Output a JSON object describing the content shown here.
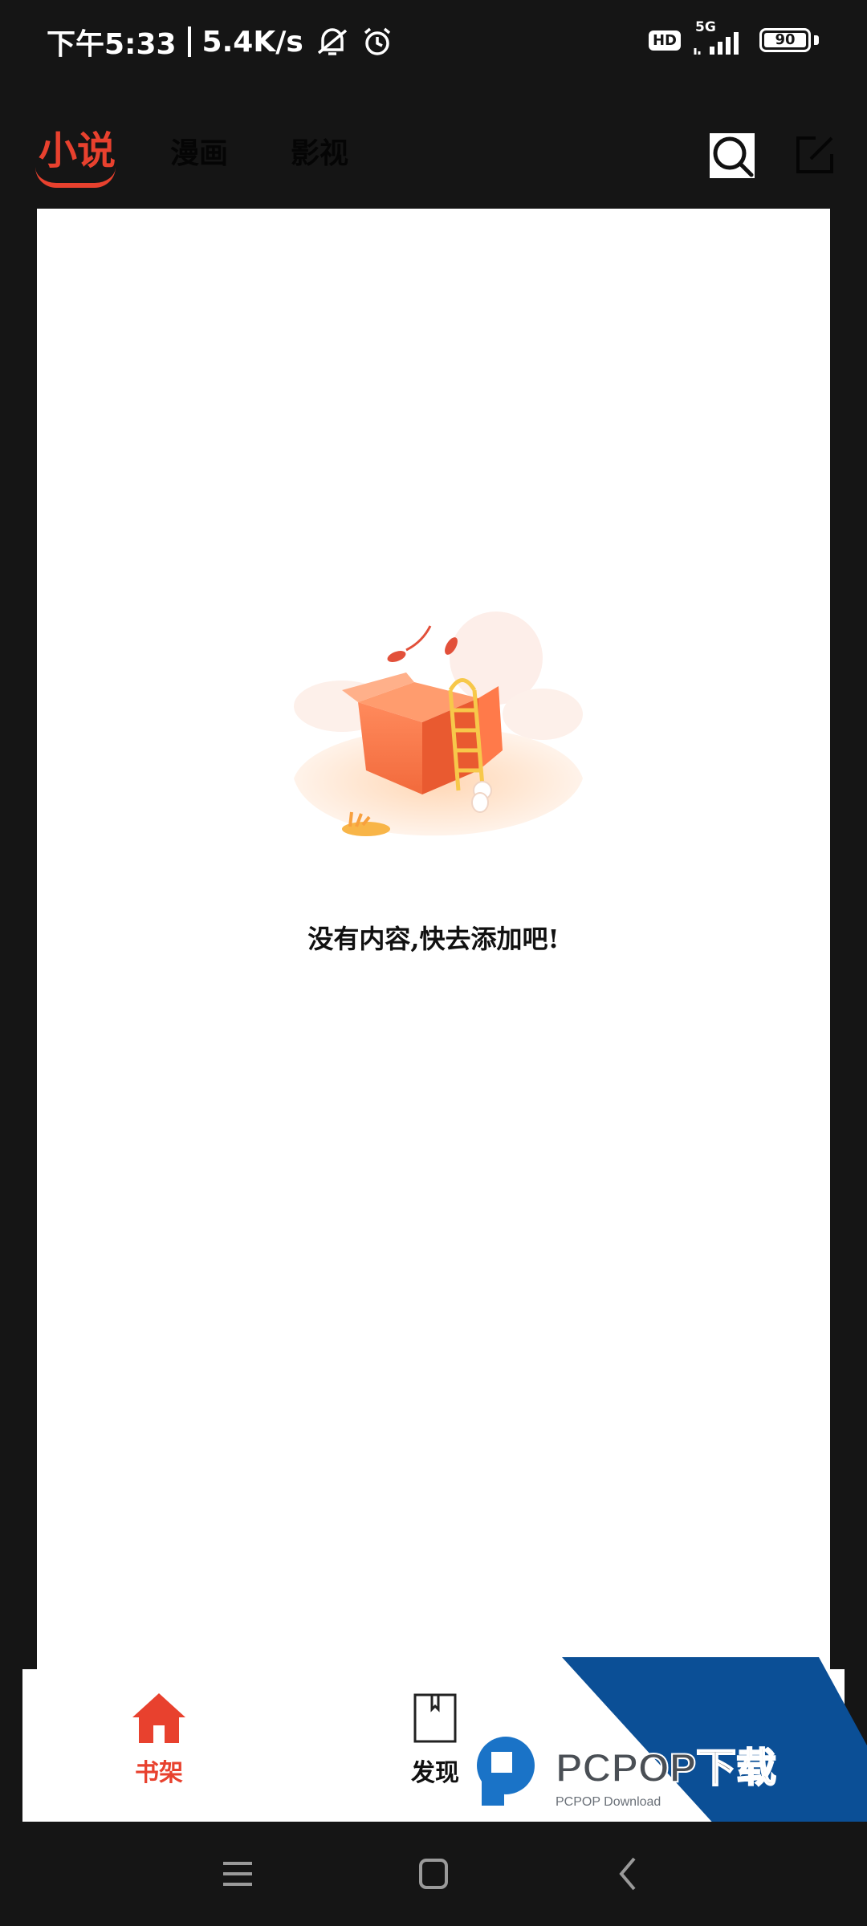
{
  "status_bar": {
    "time": "下午5:33",
    "net_speed": "5.4K/s",
    "hd_label": "HD",
    "network_type": "5G",
    "battery_level": "90"
  },
  "top_nav": {
    "tabs": [
      {
        "label": "小说",
        "active": true
      },
      {
        "label": "漫画",
        "active": false
      },
      {
        "label": "影视",
        "active": false
      }
    ]
  },
  "main": {
    "empty_message": "没有内容,快去添加吧!"
  },
  "bottom_nav": {
    "items": [
      {
        "label": "书架",
        "active": true,
        "icon": "home-icon"
      },
      {
        "label": "发现",
        "active": false,
        "icon": "bookmark-icon"
      }
    ]
  },
  "watermark": {
    "brand": "PCPOP下载",
    "sub": "PCPOP Download"
  },
  "colors": {
    "accent": "#e8412e",
    "background": "#151515",
    "watermark_blue": "#0b4f96"
  }
}
